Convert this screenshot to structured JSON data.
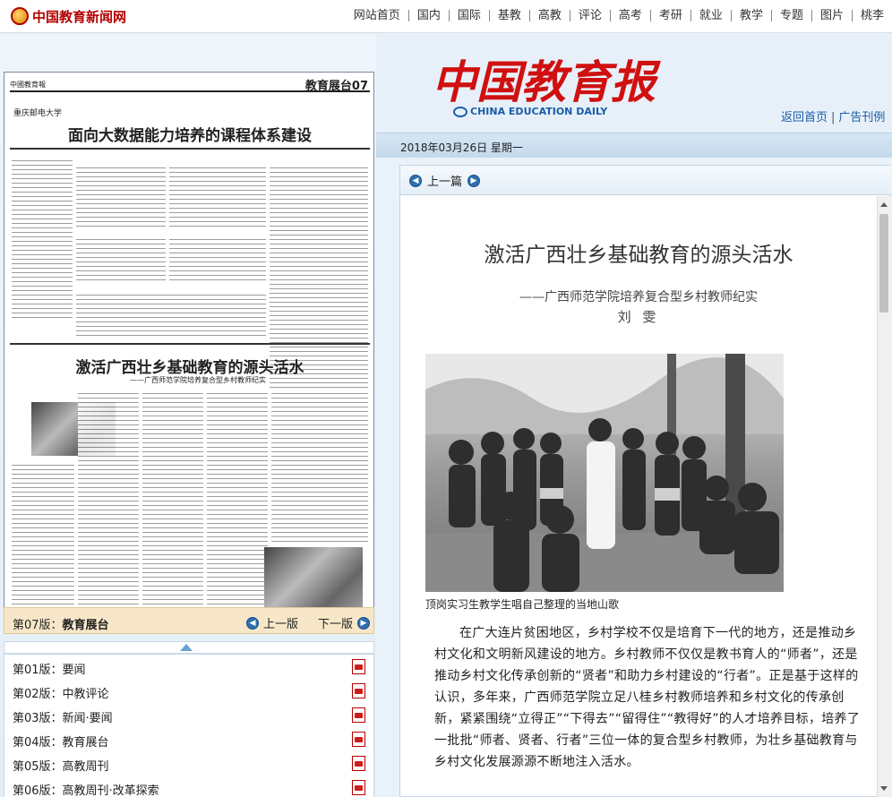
{
  "site": {
    "logo_text": "中国教育新闻网",
    "nav": [
      "网站首页",
      "国内",
      "国际",
      "基教",
      "高教",
      "评论",
      "高考",
      "考研",
      "就业",
      "教学",
      "专题",
      "图片",
      "桃李"
    ]
  },
  "masthead": {
    "title": "中国教育报",
    "en_title": "CHINA EDUCATION DAILY",
    "home_link": "返回首页",
    "ad_link": "广告刊例",
    "sep": "|"
  },
  "date": "2018年03月26日  星期一",
  "paper_thumb": {
    "masthead": "中國教育報",
    "section": "教育展台07",
    "school": "重庆邮电大学",
    "headline1": "面向大数据能力培养的课程体系建设",
    "headline2": "激活广西壮乡基础教育的源头活水",
    "headline2_sub": "——广西师范学院培养复合型乡村教师纪实"
  },
  "edition": {
    "current_prefix": "第07版：",
    "current_name": "教育展台",
    "prev": "上一版",
    "next": "下一版"
  },
  "pages": [
    {
      "label": "第01版：要闻"
    },
    {
      "label": "第02版：中教评论"
    },
    {
      "label": "第03版：新闻·要闻"
    },
    {
      "label": "第04版：教育展台"
    },
    {
      "label": "第05版：高教周刊"
    },
    {
      "label": "第06版：高教周刊·改革探索"
    }
  ],
  "article": {
    "prev_label": "上一篇",
    "title": "激活广西壮乡基础教育的源头活水",
    "subtitle": "——广西师范学院培养复合型乡村教师纪实",
    "author": "刘 雯",
    "caption": "顶岗实习生教学生唱自己整理的当地山歌",
    "body": "在广大连片贫困地区，乡村学校不仅是培育下一代的地方，还是推动乡村文化和文明新风建设的地方。乡村教师不仅仅是教书育人的“师者”，还是推动乡村文化传承创新的“贤者”和助力乡村建设的“行者”。正是基于这样的认识，多年来，广西师范学院立足八桂乡村教师培养和乡村文化的传承创新，紧紧围绕“立得正”“下得去”“留得住”“教得好”的人才培养目标，培养了一批批“师者、贤者、行者”三位一体的复合型乡村教师，为壮乡基础教育与乡村文化发展源源不断地注入活水。"
  },
  "icons": {
    "up_arrow": "up-arrow-icon",
    "pdf": "pdf-icon",
    "prev_circle": "left-circle-arrow-icon",
    "next_circle": "right-circle-arrow-icon"
  },
  "colors": {
    "brand_red": "#d01010",
    "link_blue": "#1a5da8",
    "edition_bar": "#f7e7c8",
    "background": "#e9f2f9"
  }
}
